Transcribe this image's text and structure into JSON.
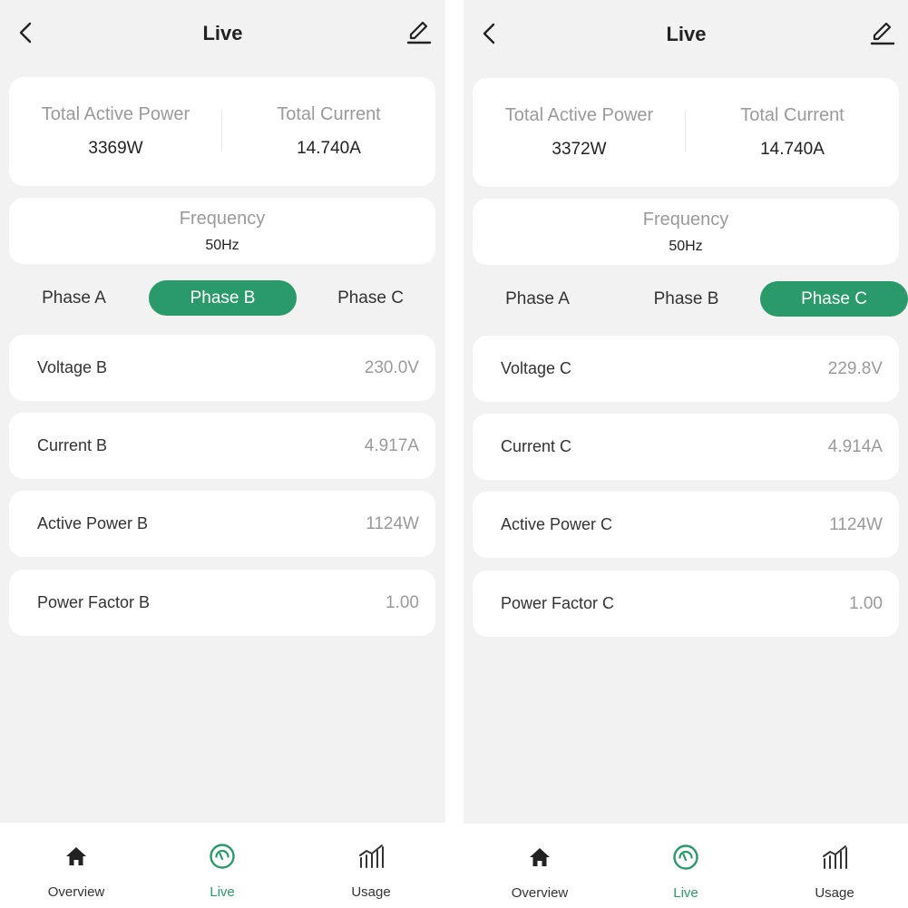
{
  "colors": {
    "accent": "#2a9a6a",
    "background": "#f2f2f2",
    "card": "#ffffff",
    "muted_text": "#9a9a9a"
  },
  "screens": [
    {
      "header": {
        "title": "Live",
        "back_icon": "chevron-left-icon",
        "edit_icon": "pencil-icon"
      },
      "totals": {
        "active_power_label": "Total Active Power",
        "active_power_value": "3369W",
        "current_label": "Total Current",
        "current_value": "14.740A"
      },
      "frequency": {
        "label": "Frequency",
        "value": "50Hz"
      },
      "tabs": [
        {
          "label": "Phase A"
        },
        {
          "label": "Phase B"
        },
        {
          "label": "Phase C"
        }
      ],
      "active_tab": "Phase B",
      "rows": [
        {
          "label": "Voltage B",
          "value": "230.0V"
        },
        {
          "label": "Current B",
          "value": "4.917A"
        },
        {
          "label": "Active Power B",
          "value": "1124W"
        },
        {
          "label": "Power Factor B",
          "value": "1.00"
        }
      ],
      "nav": [
        {
          "label": "Overview",
          "icon": "home-icon"
        },
        {
          "label": "Live",
          "icon": "gauge-icon"
        },
        {
          "label": "Usage",
          "icon": "bar-chart-icon"
        }
      ],
      "active_nav": "Live"
    },
    {
      "header": {
        "title": "Live",
        "back_icon": "chevron-left-icon",
        "edit_icon": "pencil-icon"
      },
      "totals": {
        "active_power_label": "Total Active Power",
        "active_power_value": "3372W",
        "current_label": "Total Current",
        "current_value": "14.740A"
      },
      "frequency": {
        "label": "Frequency",
        "value": "50Hz"
      },
      "tabs": [
        {
          "label": "Phase A"
        },
        {
          "label": "Phase B"
        },
        {
          "label": "Phase C"
        }
      ],
      "active_tab": "Phase C",
      "rows": [
        {
          "label": "Voltage C",
          "value": "229.8V"
        },
        {
          "label": "Current C",
          "value": "4.914A"
        },
        {
          "label": "Active Power C",
          "value": "1124W"
        },
        {
          "label": "Power Factor C",
          "value": "1.00"
        }
      ],
      "nav": [
        {
          "label": "Overview",
          "icon": "home-icon"
        },
        {
          "label": "Live",
          "icon": "gauge-icon"
        },
        {
          "label": "Usage",
          "icon": "bar-chart-icon"
        }
      ],
      "active_nav": "Live"
    }
  ]
}
